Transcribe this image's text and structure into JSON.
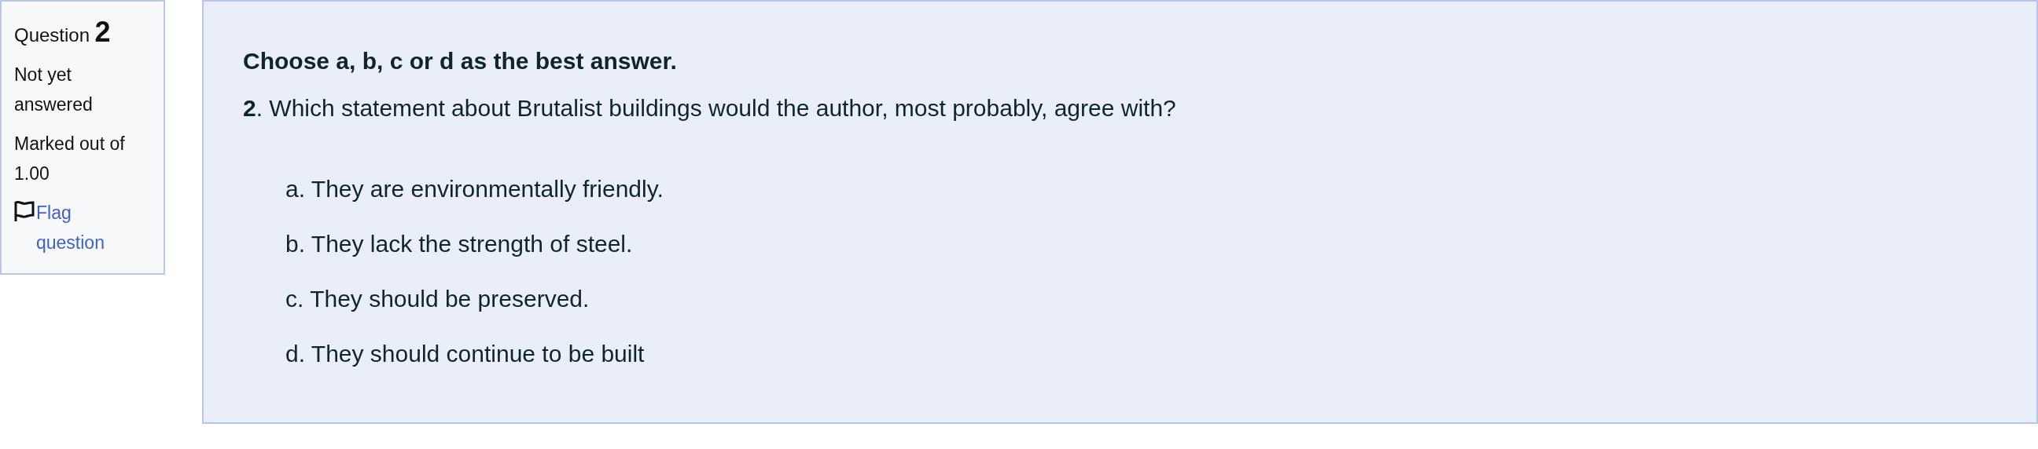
{
  "info": {
    "label": "Question",
    "number": "2",
    "status": "Not yet answered",
    "mark": "Marked out of 1.00",
    "flag": {
      "label": "Flag question",
      "flagged": false
    }
  },
  "question": {
    "instruction": "Choose a, b, c or d as the best answer.",
    "text": "**2**. Which statement about Brutalist buildings would the author, most probably, agree with?",
    "options": [
      {
        "letter": "a.",
        "text": "They are environmentally friendly."
      },
      {
        "letter": "b.",
        "text": "They lack the strength of steel."
      },
      {
        "letter": "c.",
        "text": "They should be preserved."
      },
      {
        "letter": "d.",
        "text": "They should continue to be built"
      }
    ]
  }
}
